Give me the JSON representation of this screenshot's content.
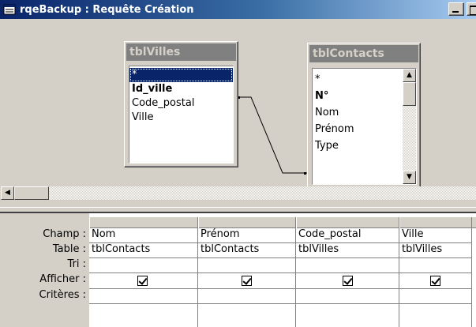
{
  "window": {
    "title": "rqeBackup : Requête Création"
  },
  "tables": {
    "villes": {
      "name": "tblVilles",
      "fields": [
        "*",
        "Id_ville",
        "Code_postal",
        "Ville"
      ],
      "selected": "*",
      "key_field": "Id_ville"
    },
    "contacts": {
      "name": "tblContacts",
      "fields": [
        "*",
        "N°",
        "Nom",
        "Prénom",
        "Type"
      ],
      "key_field": "N°"
    }
  },
  "relationship": {
    "from": "tblVilles.Id_ville",
    "to": "tblContacts.Type"
  },
  "grid": {
    "row_labels": [
      "Champ :",
      "Table :",
      "Tri :",
      "Afficher :",
      "Critères :"
    ],
    "columns": [
      {
        "champ": "Nom",
        "table": "tblContacts",
        "tri": "",
        "afficher": true,
        "criteres": ""
      },
      {
        "champ": "Prénom",
        "table": "tblContacts",
        "tri": "",
        "afficher": true,
        "criteres": ""
      },
      {
        "champ": "Code_postal",
        "table": "tblVilles",
        "tri": "",
        "afficher": true,
        "criteres": ""
      },
      {
        "champ": "Ville",
        "table": "tblVilles",
        "tri": "",
        "afficher": true,
        "criteres": ""
      }
    ]
  },
  "icons": {
    "app": "query-design-icon",
    "minimize": "minimize-icon",
    "maximize": "maximize-icon",
    "scroll_up": "arrow-up-icon",
    "scroll_down": "arrow-down-icon",
    "scroll_left": "arrow-left-icon",
    "checkbox": "checkbox-checked-icon"
  },
  "colors": {
    "title_bar_start": "#0a246a",
    "title_bar_end": "#a6caf0",
    "table_title_bg": "#808080",
    "selection": "#0a246a",
    "face": "#d4d0c8"
  }
}
